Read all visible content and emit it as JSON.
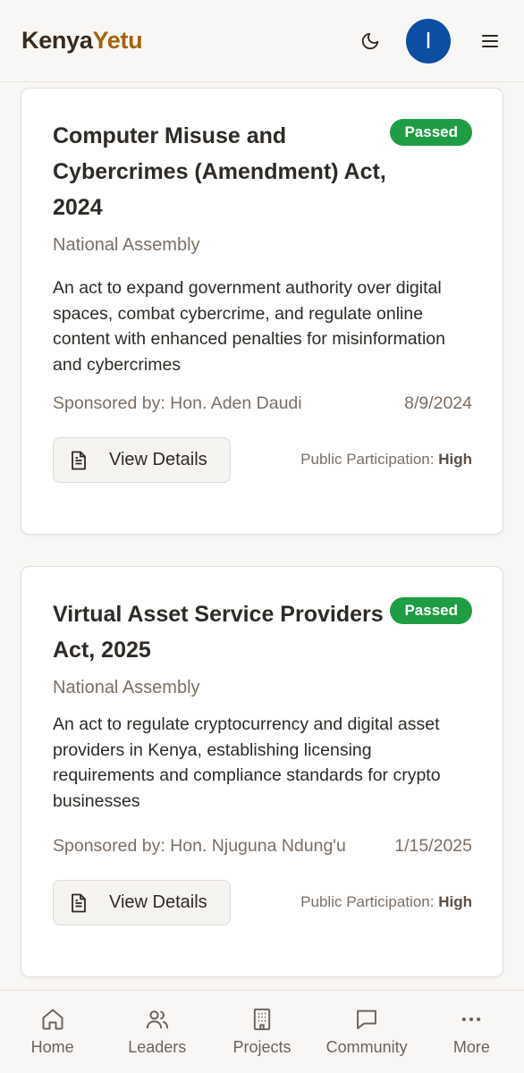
{
  "header": {
    "logo_part1": "Kenya",
    "logo_part2": "Yetu",
    "avatar_initial": "I",
    "theme_icon": "moon-icon",
    "menu_icon": "hamburger-icon"
  },
  "bills": [
    {
      "title": "Computer Misuse and Cybercrimes (Amendment) Act, 2024",
      "status": "Passed",
      "chamber": "National Assembly",
      "description": "An act to expand government authority over digital spaces, combat cybercrime, and regulate online content with enhanced penalties for misinformation and cybercrimes",
      "sponsor": "Sponsored by: Hon. Aden Daudi",
      "date": "8/9/2024",
      "button_label": "View Details",
      "participation_label": "Public Participation:",
      "participation_value": "High"
    },
    {
      "title": "Virtual Asset Service Providers Act, 2025",
      "status": "Passed",
      "chamber": "National Assembly",
      "description": "An act to regulate cryptocurrency and digital asset providers in Kenya, establishing licensing requirements and compliance standards for crypto businesses",
      "sponsor": "Sponsored by: Hon. Njuguna Ndung'u",
      "date": "1/15/2025",
      "button_label": "View Details",
      "participation_label": "Public Participation:",
      "participation_value": "High"
    }
  ],
  "nav": {
    "items": [
      {
        "label": "Home",
        "icon": "home-icon"
      },
      {
        "label": "Leaders",
        "icon": "users-icon"
      },
      {
        "label": "Projects",
        "icon": "building-icon"
      },
      {
        "label": "Community",
        "icon": "chat-icon"
      },
      {
        "label": "More",
        "icon": "more-icon"
      }
    ]
  },
  "colors": {
    "accent_logo": "#a8620c",
    "badge_green": "#1f9d45",
    "avatar_blue": "#0b4ea2"
  }
}
